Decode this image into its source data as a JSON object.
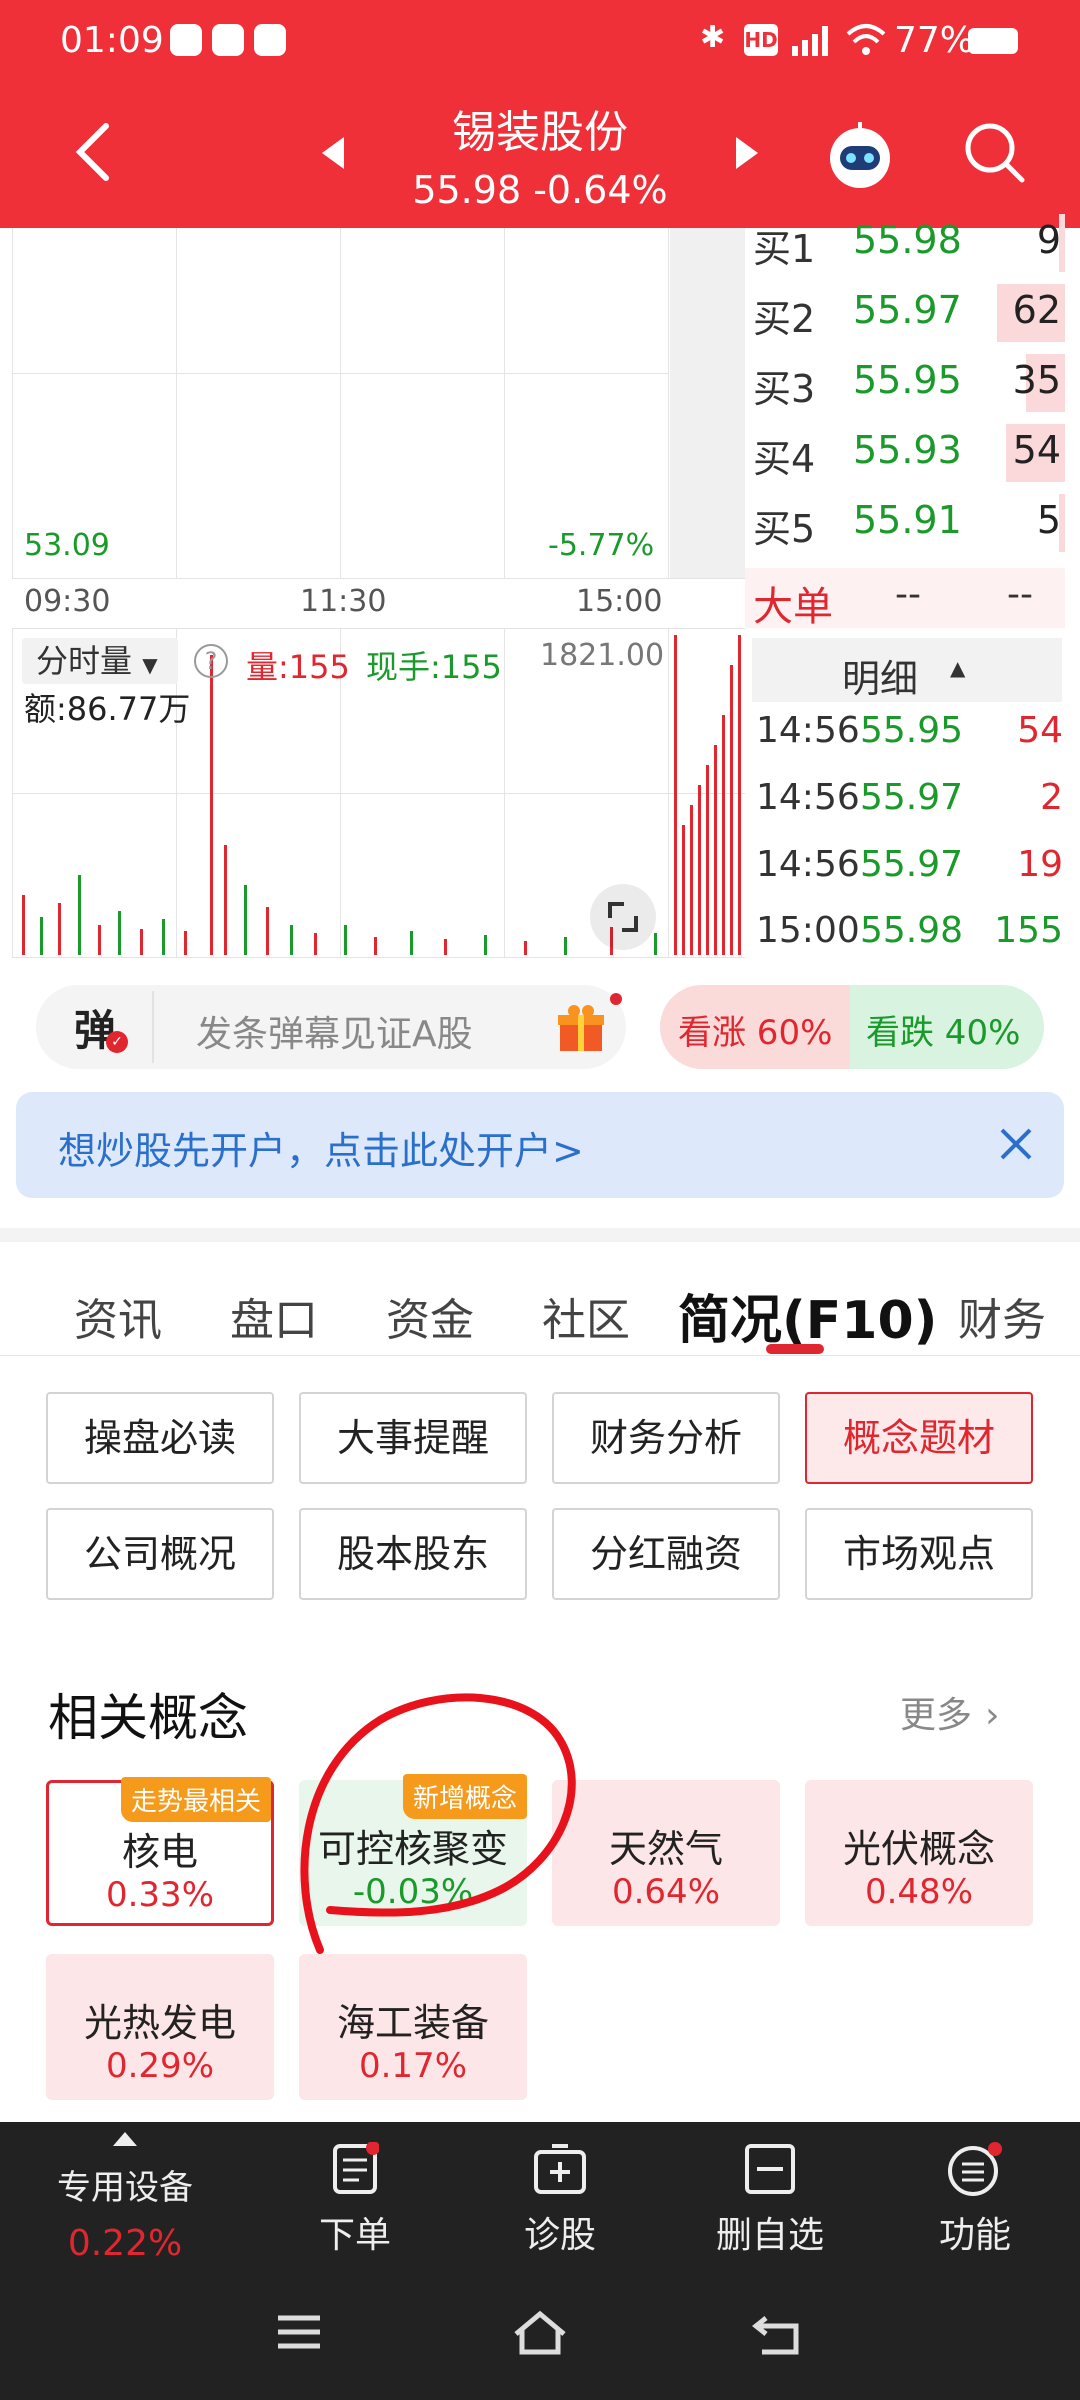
{
  "status_bar": {
    "time": "01:09",
    "battery": "77%"
  },
  "header": {
    "title": "锡装股份",
    "price": "55.98",
    "change": "-0.64%"
  },
  "chart": {
    "low_price": "53.09",
    "low_pct": "-5.77%",
    "time_labels": [
      "09:30",
      "11:30",
      "15:00"
    ],
    "volume_mode": "分时量",
    "volume": "量:155",
    "current_hand": "现手:155",
    "volume_max": "1821.00",
    "amount": "额:86.77万"
  },
  "order_book": {
    "bids": [
      {
        "label": "买1",
        "price": "55.98",
        "qty": "9",
        "fill": 0.05
      },
      {
        "label": "买2",
        "price": "55.97",
        "qty": "62",
        "fill": 0.62
      },
      {
        "label": "买3",
        "price": "55.95",
        "qty": "35",
        "fill": 0.35
      },
      {
        "label": "买4",
        "price": "55.93",
        "qty": "54",
        "fill": 0.54
      },
      {
        "label": "买5",
        "price": "55.91",
        "qty": "5",
        "fill": 0.05
      }
    ],
    "big_order_label": "大单",
    "big_order_a": "--",
    "big_order_b": "--",
    "detail_label": "明细"
  },
  "ticks": [
    {
      "time": "14:56",
      "price": "55.95",
      "qty": "54"
    },
    {
      "time": "14:56",
      "price": "55.97",
      "qty": "2"
    },
    {
      "time": "14:56",
      "price": "55.97",
      "qty": "19"
    },
    {
      "time": "15:00",
      "price": "55.98",
      "qty": "155"
    }
  ],
  "barrage": {
    "icon_char": "弹",
    "placeholder": "发条弹幕见证A股"
  },
  "sentiment": {
    "up": "看涨 60%",
    "down": "看跌 40%",
    "up_pct": 60
  },
  "promo": {
    "text": "想炒股先开户，点击此处开户>"
  },
  "tabs": {
    "items": [
      "资讯",
      "盘口",
      "资金",
      "社区",
      "简况(F10)",
      "财务"
    ],
    "active_index": 4
  },
  "f10_buttons": {
    "row1": [
      "操盘必读",
      "大事提醒",
      "财务分析",
      "概念题材"
    ],
    "row2": [
      "公司概况",
      "股本股东",
      "分红融资",
      "市场观点"
    ],
    "active": "概念题材"
  },
  "concepts": {
    "section_title": "相关概念",
    "more": "更多",
    "items": [
      {
        "name": "核电",
        "value": "0.33%",
        "badge": "走势最相关"
      },
      {
        "name": "可控核聚变",
        "value": "-0.03%",
        "badge": "新增概念"
      },
      {
        "name": "天然气",
        "value": "0.64%",
        "badge": ""
      },
      {
        "name": "光伏概念",
        "value": "0.48%",
        "badge": ""
      },
      {
        "name": "光热发电",
        "value": "0.29%",
        "badge": ""
      },
      {
        "name": "海工装备",
        "value": "0.17%",
        "badge": ""
      }
    ]
  },
  "bottom_bar": {
    "sector_name": "专用设备",
    "sector_change": "0.22%",
    "items": [
      "下单",
      "诊股",
      "删自选",
      "功能"
    ]
  },
  "colors": {
    "brand_red": "#ef3039",
    "down_green": "#1a9a2a",
    "up_red": "#e0272f"
  }
}
